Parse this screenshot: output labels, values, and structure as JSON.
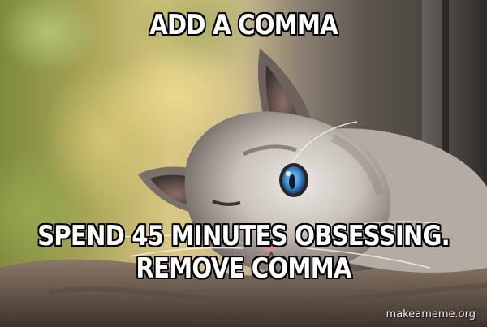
{
  "meme": {
    "top_text": "ADD A COMMA",
    "bottom_text_line1": "SPEND 45 MINUTES OBSESSING.",
    "bottom_text_line2": "REMOVE COMMA",
    "watermark": "makeameme.org"
  },
  "image_subject": "cat-photo",
  "colors": {
    "caption_fill": "#ffffff",
    "caption_outline": "#000000",
    "cat_eye": "#3f8fd0"
  }
}
